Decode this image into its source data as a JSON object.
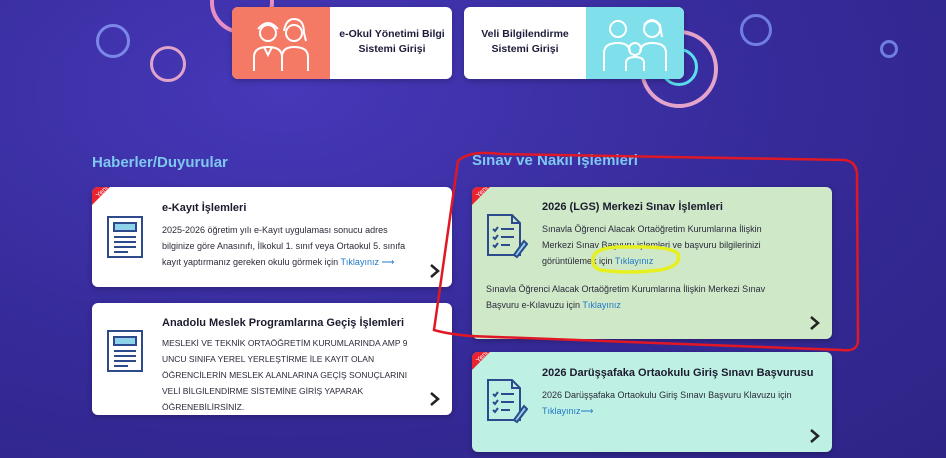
{
  "top_cards": {
    "eokul": {
      "label_line1": "e-Okul Yönetimi Bilgi",
      "label_line2": "Sistemi Girişi"
    },
    "veli": {
      "label_line1": "Veli Bilgilendirme",
      "label_line2": "Sistemi Girişi"
    }
  },
  "sections": {
    "news_title": "Haberler/Duyurular",
    "exam_title": "Sınav ve Nakil İşlemleri"
  },
  "badge": {
    "label": "Yeni"
  },
  "news": [
    {
      "title": "e-Kayıt İşlemleri",
      "lines": [
        "2025-2026 öğretim yılı e-Kayıt uygulaması sonucu adres",
        "bilginize göre Anasınıfı, İlkokul 1. sınıf veya Ortaokul 5. sınıfa",
        "kayıt yaptırmanız gereken okulu görmek için"
      ],
      "link": "Tıklayınız ⟶"
    },
    {
      "title": "Anadolu Meslek Programlarına Geçiş İşlemleri",
      "lines": [
        "MESLEKİ VE TEKNİK ORTAÖĞRETİM KURUMLARINDA AMP 9",
        "UNCU SINIFA YEREL YERLEŞTİRME İLE KAYIT OLAN",
        "ÖĞRENCİLERİN MESLEK ALANLARINA GEÇİŞ SONUÇLARINI",
        "VELİ BİLGİLENDİRME SİSTEMİNE GİRİŞ YAPARAK ÖĞRENEBİLİRSİNİZ."
      ]
    }
  ],
  "exams": [
    {
      "title": "2026 (LGS) Merkezi Sınav İşlemleri",
      "lines": [
        "Sınavla Öğrenci Alacak Ortaöğretim Kurumlarına İlişkin",
        "Merkezi Sınav Başvuru işlemleri ve başvuru bilgilerinizi",
        "görüntülemek için"
      ],
      "link1": "Tıklayınız",
      "lines2": [
        "Sınavla Öğrenci Alacak Ortaöğretim Kurumlarına İlişkin Merkezi Sınav",
        "Başvuru e-Kılavuzu için"
      ],
      "link2": "Tıklayınız"
    },
    {
      "title": "2026 Darüşşafaka Ortaokulu Giriş Sınavı Başvurusu",
      "line": "2026 Darüşşafaka Ortaokulu Giriş Sınavı Başvuru Klavuzu için",
      "link": "Tıklayınız⟶"
    }
  ],
  "colors": {
    "background": "#3a2fa3",
    "section_title": "#7ec8f0",
    "lgs_card": "#cfe8c8",
    "darussafaka_card": "#bff0e4",
    "ribbon": "#e8232f",
    "annotation_red": "#e01825",
    "highlight_yellow": "#e6f020",
    "eokul_icon_bg": "#f47a66",
    "veli_icon_bg": "#7fe0ec"
  },
  "icons": {
    "eokul": "teachers-icon",
    "veli": "family-icon",
    "news": "newspaper-icon",
    "exam": "checklist-icon",
    "arrow": "chevron-right-icon"
  }
}
